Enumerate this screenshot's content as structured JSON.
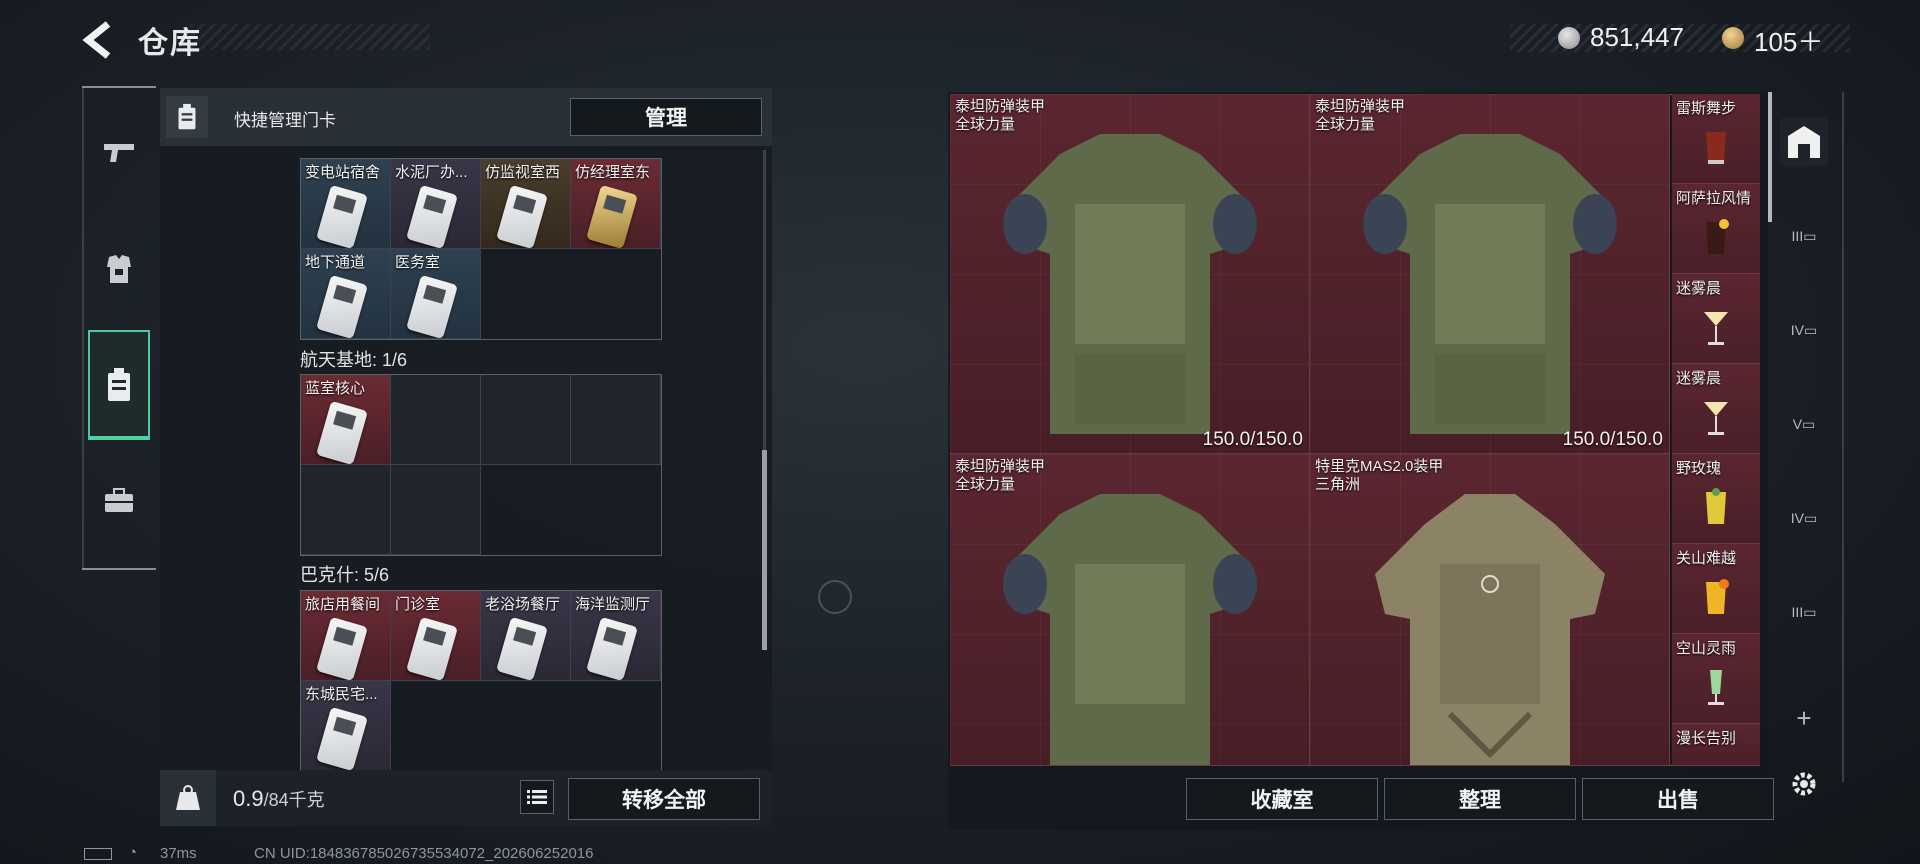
{
  "header": {
    "title": "仓库"
  },
  "currency": {
    "silver": "851,447",
    "gold": "105＋"
  },
  "left_rail": [
    {
      "name": "gun",
      "icon": "gun-icon"
    },
    {
      "name": "armor",
      "icon": "armor-icon"
    },
    {
      "name": "keycard",
      "icon": "keycard-icon",
      "active": true
    },
    {
      "name": "toolbox",
      "icon": "toolbox-icon"
    }
  ],
  "left_panel": {
    "title": "快捷管理门卡",
    "manage_label": "管理",
    "sections": [
      {
        "label": "",
        "items": [
          {
            "label": "变电站宿舍",
            "rarity": "blue"
          },
          {
            "label": "水泥厂办...",
            "rarity": "purple"
          },
          {
            "label": "仿监视室西",
            "rarity": "gold"
          },
          {
            "label": "仿经理室东",
            "rarity": "red"
          },
          {
            "label": "地下通道",
            "rarity": "blue"
          },
          {
            "label": "医务室",
            "rarity": "blue"
          }
        ]
      },
      {
        "label": "航天基地: 1/6",
        "items": [
          {
            "label": "蓝室核心",
            "rarity": "red"
          }
        ]
      },
      {
        "label": "巴克什: 5/6",
        "items": [
          {
            "label": "旅店用餐间",
            "rarity": "red"
          },
          {
            "label": "门诊室",
            "rarity": "red"
          },
          {
            "label": "老浴场餐厅",
            "rarity": "purple"
          },
          {
            "label": "海洋监测厅",
            "rarity": "purple"
          },
          {
            "label": "东城民宅...",
            "rarity": "purple"
          }
        ]
      }
    ],
    "weight": "0.9",
    "weight_max": "/84千克",
    "transfer_label": "转移全部"
  },
  "right_panel": {
    "armors": [
      {
        "name": "泰坦防弹装甲",
        "sub": "全球力量",
        "durability": "150.0/150.0"
      },
      {
        "name": "泰坦防弹装甲",
        "sub": "全球力量",
        "durability": "150.0/150.0"
      },
      {
        "name": "泰坦防弹装甲",
        "sub": "全球力量",
        "durability": ""
      },
      {
        "name": "特里克MAS2.0装甲",
        "sub": "三角洲",
        "durability": ""
      }
    ],
    "drinks": [
      "雷斯舞步",
      "阿萨拉风情",
      "迷雾晨",
      "迷雾晨",
      "野玫瑰",
      "关山难越",
      "空山灵雨",
      "漫长告别"
    ],
    "buttons": {
      "collection": "收藏室",
      "sort": "整理",
      "sell": "出售"
    }
  },
  "right_rail": [
    "III",
    "IV",
    "V",
    "IV",
    "III",
    "+"
  ],
  "status": {
    "ping": "37ms",
    "uid": "CN UID:184836785026735534072_202606252016"
  },
  "colors": {
    "accent": "#52d29e",
    "item_red": "#5b2630"
  }
}
